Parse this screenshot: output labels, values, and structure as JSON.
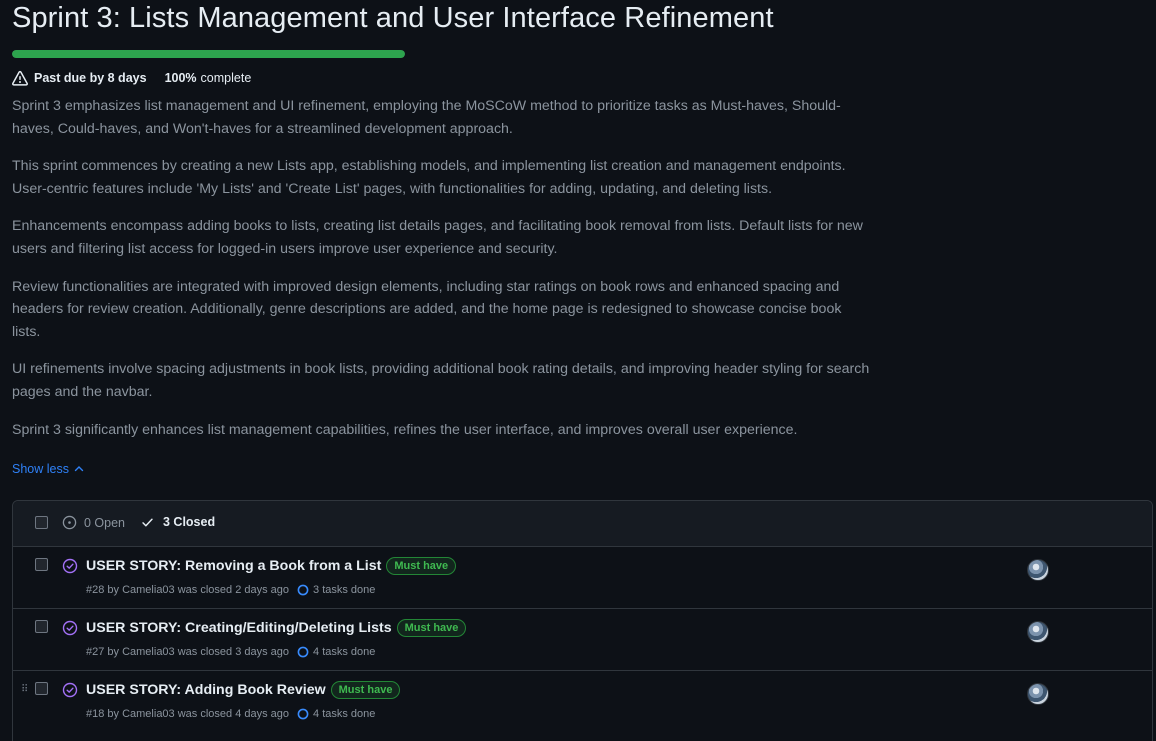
{
  "milestone": {
    "title": "Sprint 3: Lists Management and User Interface Refinement",
    "progress_fraction": 1.0,
    "accent_color": "#2da44e",
    "due_status": "Past due by 8 days",
    "percent": "100%",
    "percent_label": "complete",
    "description": [
      "Sprint 3 emphasizes list management and UI refinement, employing the MoSCoW method to prioritize tasks as Must-haves, Should-haves, Could-haves, and Won't-haves for a streamlined development approach.",
      "This sprint commences by creating a new Lists app, establishing models, and implementing list creation and management endpoints. User-centric features include 'My Lists' and 'Create List' pages, with functionalities for adding, updating, and deleting lists.",
      "Enhancements encompass adding books to lists, creating list details pages, and facilitating book removal from lists. Default lists for new users and filtering list access for logged-in users improve user experience and security.",
      "Review functionalities are integrated with improved design elements, including star ratings on book rows and enhanced spacing and headers for review creation. Additionally, genre descriptions are added, and the home page is redesigned to showcase concise book lists.",
      "UI refinements involve spacing adjustments in book lists, providing additional book rating details, and improving header styling for search pages and the navbar.",
      "Sprint 3 significantly enhances list management capabilities, refines the user interface, and improves overall user experience."
    ],
    "show_less": "Show less"
  },
  "issues": {
    "open_label": "0 Open",
    "closed_label": "3 Closed",
    "items": [
      {
        "title": "USER STORY: Removing a Book from a List",
        "label": "Must have",
        "meta": "#28 by Camelia03 was closed 2 days ago",
        "tasks": "3 tasks done",
        "icon": "issue-closed-icon"
      },
      {
        "title": "USER STORY: Creating/Editing/Deleting Lists",
        "label": "Must have",
        "meta": "#27 by Camelia03 was closed 3 days ago",
        "tasks": "4 tasks done",
        "icon": "issue-closed-icon"
      },
      {
        "title": "USER STORY: Adding Book Review",
        "label": "Must have",
        "meta": "#18 by Camelia03 was closed 4 days ago",
        "tasks": "4 tasks done",
        "icon": "issue-closed-icon"
      }
    ]
  }
}
